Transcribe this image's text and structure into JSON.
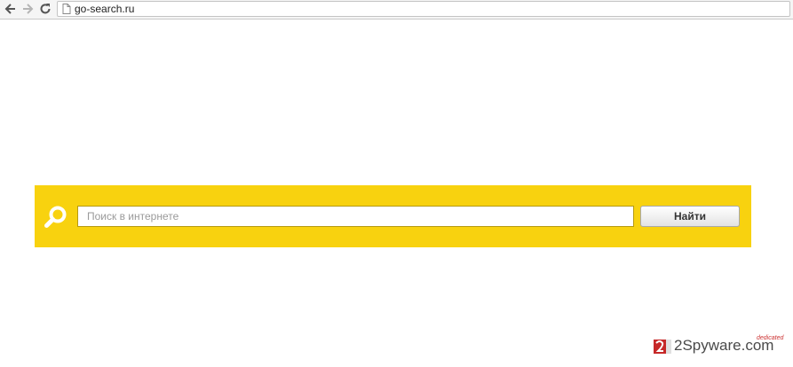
{
  "browser": {
    "url": "go-search.ru",
    "icons": {
      "back": "arrow-left-icon",
      "forward": "arrow-right-icon",
      "reload": "reload-icon",
      "page": "page-icon"
    }
  },
  "search": {
    "placeholder": "Поиск в интернете",
    "value": "",
    "button_label": "Найти",
    "icon": "magnifier-icon"
  },
  "colors": {
    "band": "#f8d20f",
    "page_bg": "#ffffff"
  },
  "watermark": {
    "text": "2Spyware.com",
    "tagline": "dedicated"
  }
}
